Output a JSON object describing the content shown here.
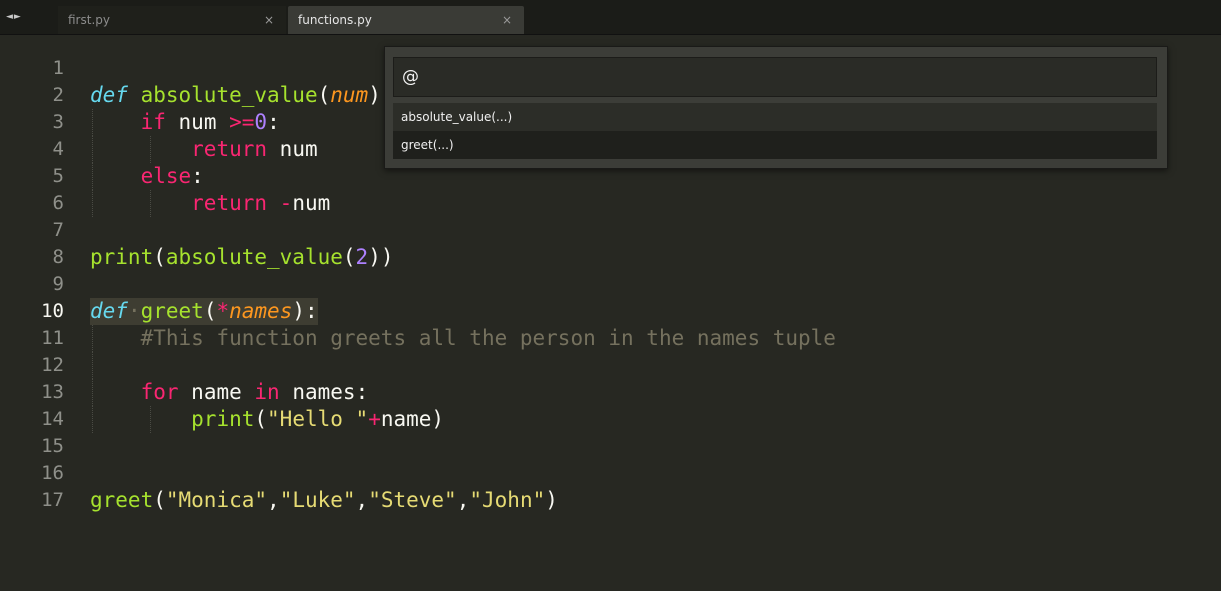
{
  "tabs": [
    {
      "label": "first.py",
      "close": "×"
    },
    {
      "label": "functions.py",
      "close": "×"
    }
  ],
  "nav_arrows": "◄►",
  "goto_symbol": {
    "query": "@",
    "results": [
      "absolute_value(...)",
      "greet(...)"
    ]
  },
  "code_lines": [
    {
      "num": "1",
      "text": ""
    },
    {
      "num": "2",
      "text": "def absolute_value(num):"
    },
    {
      "num": "3",
      "text": "    if num >=0:"
    },
    {
      "num": "4",
      "text": "        return num"
    },
    {
      "num": "5",
      "text": "    else:"
    },
    {
      "num": "6",
      "text": "        return -num"
    },
    {
      "num": "7",
      "text": ""
    },
    {
      "num": "8",
      "text": "print(absolute_value(2))"
    },
    {
      "num": "9",
      "text": ""
    },
    {
      "num": "10",
      "text": "def greet(*names):"
    },
    {
      "num": "11",
      "text": "    #This function greets all the person in the names tuple"
    },
    {
      "num": "12",
      "text": ""
    },
    {
      "num": "13",
      "text": "    for name in names:"
    },
    {
      "num": "14",
      "text": "        print(\"Hello \"+name)"
    },
    {
      "num": "15",
      "text": ""
    },
    {
      "num": "16",
      "text": ""
    },
    {
      "num": "17",
      "text": "greet(\"Monica\",\"Luke\",\"Steve\",\"John\")"
    }
  ],
  "tokens": {
    "l2": [
      "def",
      "absolute_value",
      "(",
      "num",
      "):"
    ],
    "l3": [
      "if",
      "num",
      ">=",
      "0",
      ":"
    ],
    "l4": [
      "return",
      "num"
    ],
    "l5": [
      "else",
      ":"
    ],
    "l6": [
      "return",
      "-",
      "num"
    ],
    "l8": [
      "print",
      "(",
      "absolute_value",
      "(",
      "2",
      "))"
    ],
    "l10": [
      "def",
      "·",
      "greet",
      "(",
      "*",
      "names",
      "):"
    ],
    "l11": [
      "#This function greets all the person in the names tuple"
    ],
    "l13": [
      "for",
      "name",
      "in",
      "names",
      ":"
    ],
    "l14": [
      "print",
      "(",
      "\"Hello \"",
      "+",
      "name",
      ")"
    ],
    "l17": [
      "greet",
      "(",
      "\"Monica\"",
      ",",
      "\"Luke\"",
      ",",
      "\"Steve\"",
      ",",
      "\"John\"",
      ")"
    ]
  },
  "colors": {
    "background": "#272822",
    "keyword": "#f92672",
    "def_keyword": "#66d9ef",
    "function": "#a6e22e",
    "parameter": "#fd971f",
    "number": "#ae81ff",
    "string": "#e6db74",
    "comment": "#75715e",
    "text": "#f8f8f2"
  }
}
